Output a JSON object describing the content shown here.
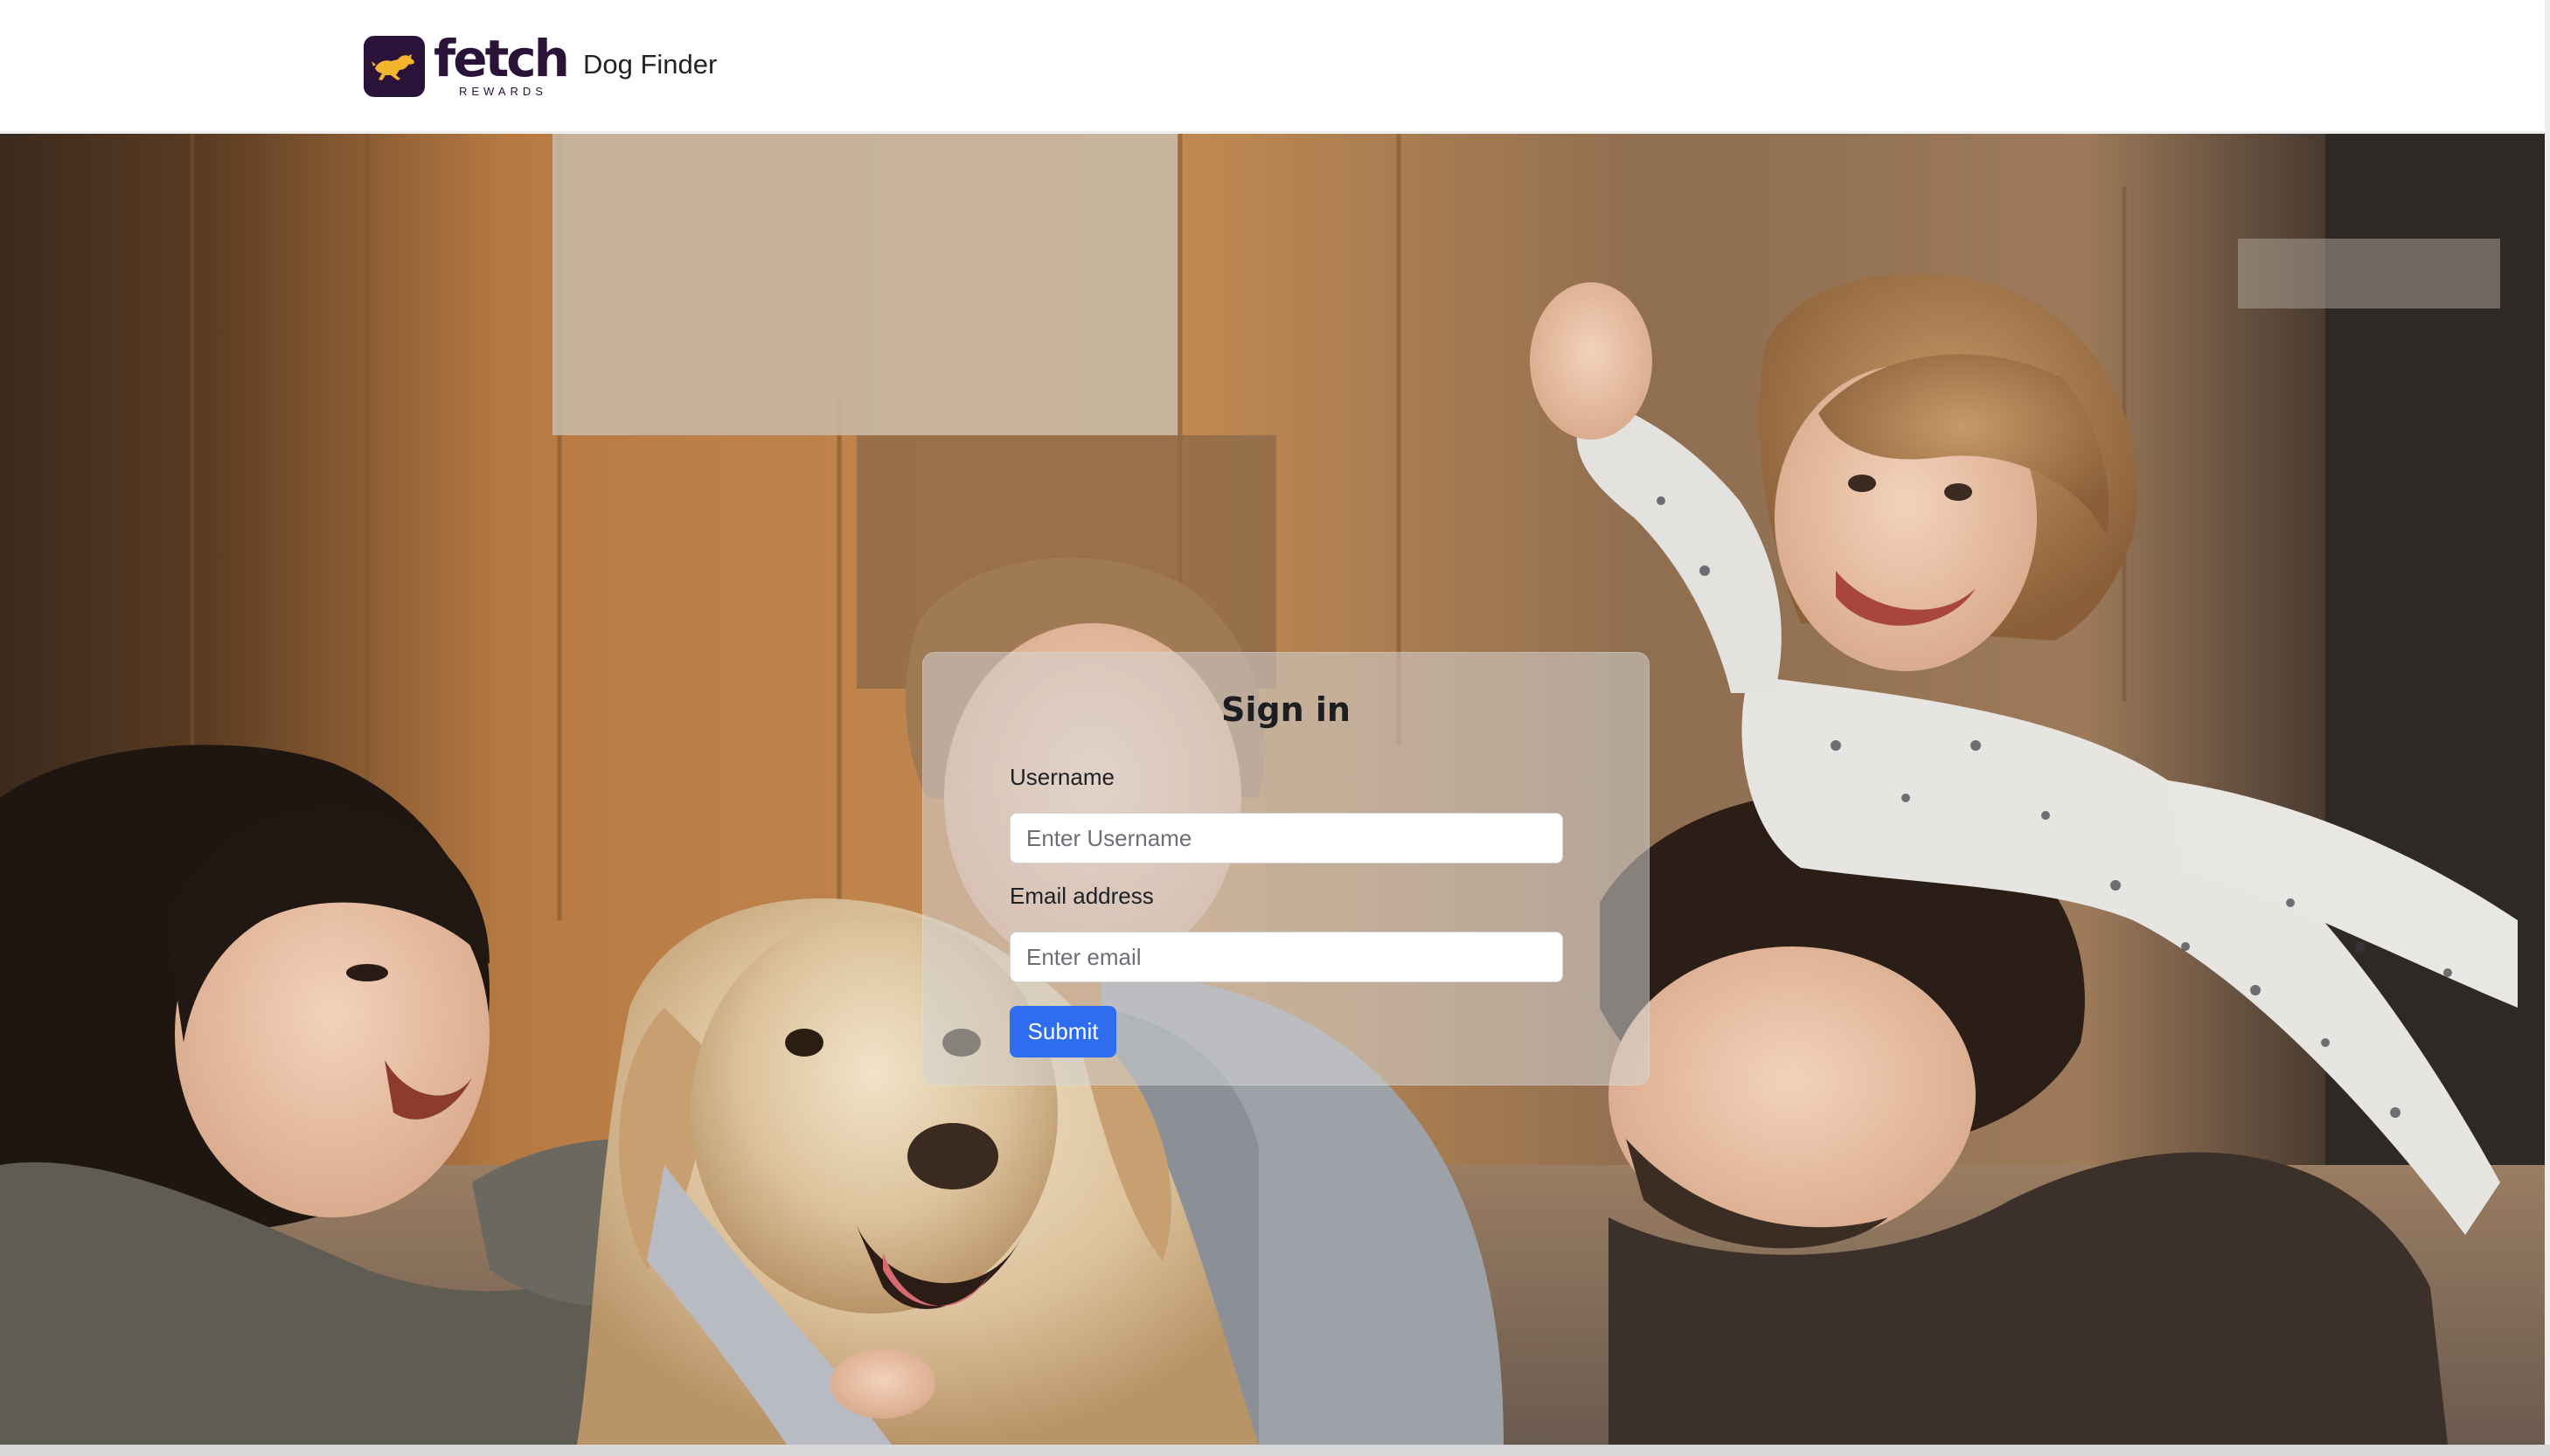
{
  "header": {
    "logo": {
      "wordmark": "fetch",
      "subtext": "REWARDS",
      "icon": "running-dog-icon",
      "brand_color": "#2b1238",
      "accent_color": "#f3b52d"
    },
    "app_name": "Dog Finder"
  },
  "hero": {
    "image": "family-with-golden-retriever-photo"
  },
  "signin": {
    "title": "Sign in",
    "username_label": "Username",
    "username_placeholder": "Enter Username",
    "username_value": "",
    "email_label": "Email address",
    "email_placeholder": "Enter email",
    "email_value": "",
    "submit_label": "Submit",
    "submit_color": "#2e6df0"
  }
}
